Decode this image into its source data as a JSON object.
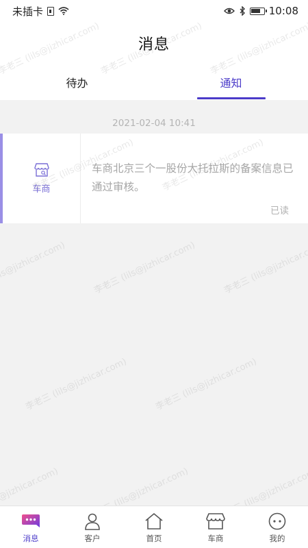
{
  "status_bar": {
    "carrier": "未插卡",
    "time": "10:08"
  },
  "header": {
    "title": "消息"
  },
  "tabs": [
    {
      "label": "待办",
      "active": false
    },
    {
      "label": "通知",
      "active": true
    }
  ],
  "notifications": [
    {
      "timestamp": "2021-02-04 10:41",
      "source": "车商",
      "source_icon": "shop-icon",
      "text": "车商北京三个一股份大托拉斯的备案信息已通过审核。",
      "status": "已读"
    }
  ],
  "watermark": {
    "text": "李老三 (lils@jizhicar.com)"
  },
  "bottom_nav": [
    {
      "label": "消息",
      "icon": "message-icon",
      "active": true
    },
    {
      "label": "客户",
      "icon": "person-icon",
      "active": false
    },
    {
      "label": "首页",
      "icon": "home-icon",
      "active": false
    },
    {
      "label": "车商",
      "icon": "shop-icon",
      "active": false
    },
    {
      "label": "我的",
      "icon": "smiley-icon",
      "active": false
    }
  ],
  "colors": {
    "accent": "#4b3bc9",
    "card_accent": "#9a8fe6",
    "background": "#f2f2f2"
  }
}
